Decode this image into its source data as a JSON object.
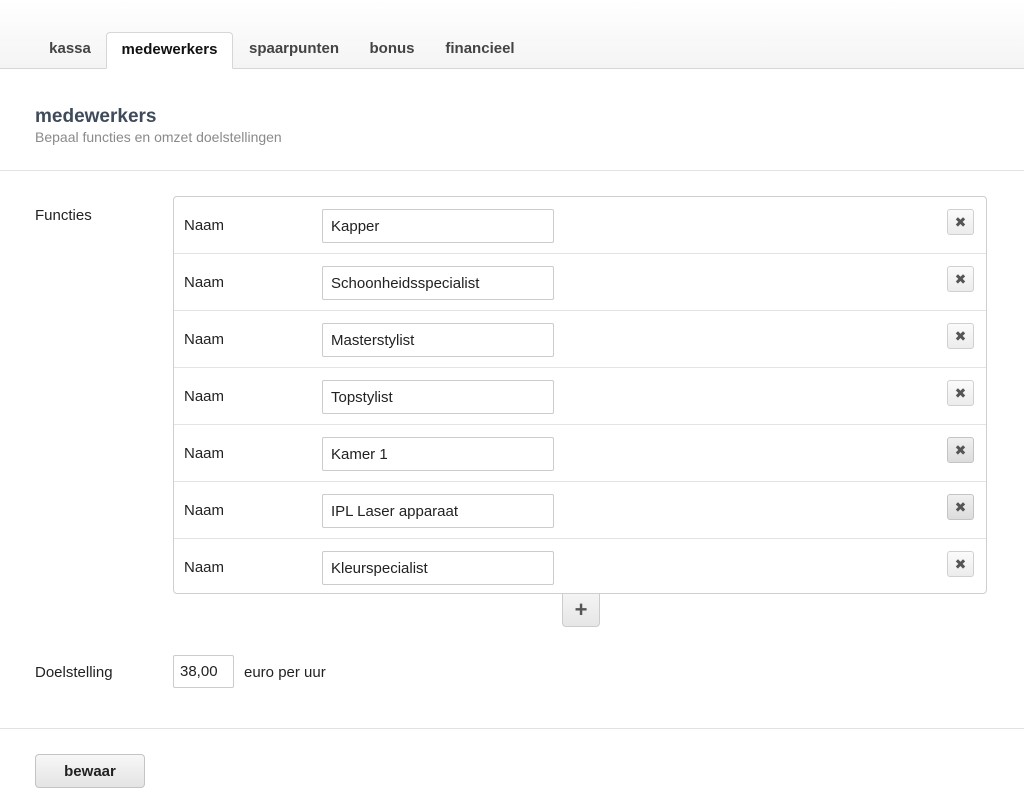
{
  "tabs": [
    {
      "label": "kassa",
      "active": false
    },
    {
      "label": "medewerkers",
      "active": true
    },
    {
      "label": "spaarpunten",
      "active": false
    },
    {
      "label": "bonus",
      "active": false
    },
    {
      "label": "financieel",
      "active": false
    }
  ],
  "header": {
    "title": "medewerkers",
    "subtitle": "Bepaal functies en omzet doelstellingen"
  },
  "functies": {
    "section_label": "Functies",
    "row_label": "Naam",
    "rows": [
      {
        "value": "Kapper"
      },
      {
        "value": "Schoonheidsspecialist"
      },
      {
        "value": "Masterstylist"
      },
      {
        "value": "Topstylist"
      },
      {
        "value": "Kamer 1"
      },
      {
        "value": "IPL Laser apparaat"
      },
      {
        "value": "Kleurspecialist"
      }
    ],
    "delete_icon": "close-icon",
    "add_icon": "plus-icon"
  },
  "doelstelling": {
    "label": "Doelstelling",
    "value": "38,00",
    "unit": "euro per uur"
  },
  "save_label": "bewaar",
  "colors": {
    "title": "#3f4a5a",
    "subtitle": "#8a8a8a",
    "border": "#cfcfcf"
  }
}
